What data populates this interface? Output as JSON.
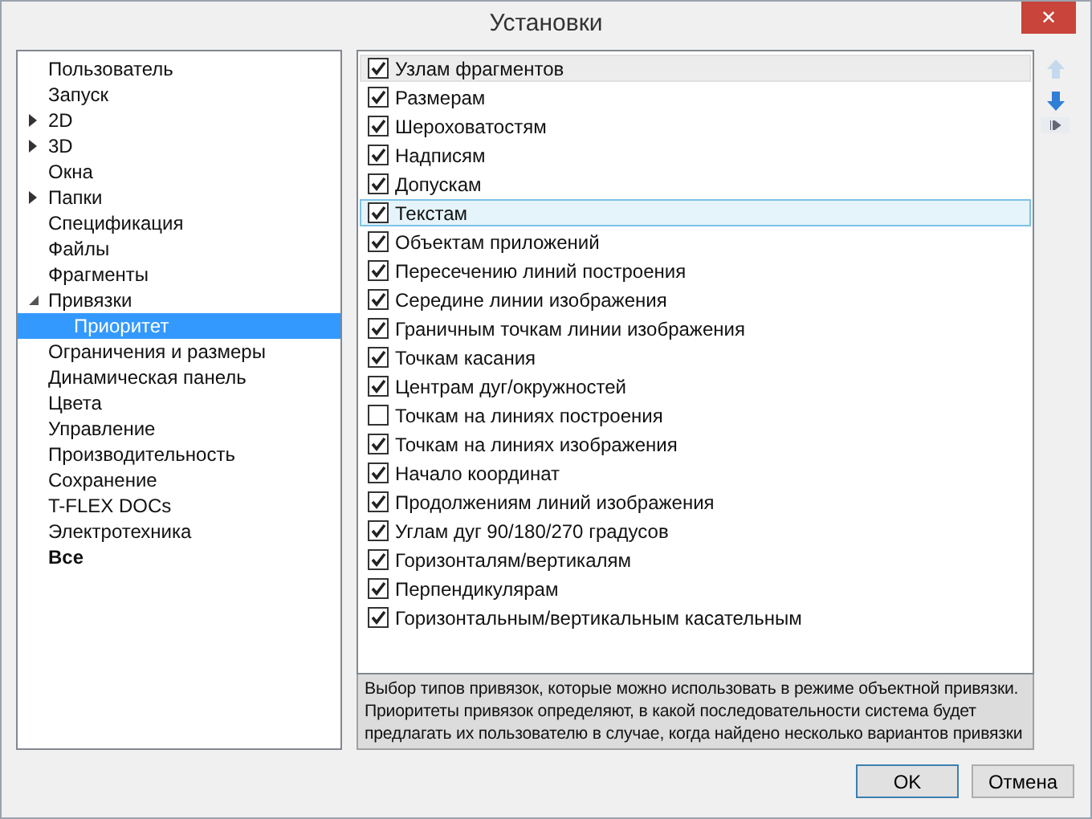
{
  "window": {
    "title": "Установки",
    "close": "✕"
  },
  "tree": [
    {
      "label": "Пользователь",
      "selected": false,
      "bold": false
    },
    {
      "label": "Запуск",
      "selected": false,
      "bold": false
    },
    {
      "label": "2D",
      "selected": false,
      "bold": false,
      "expanded": false
    },
    {
      "label": "3D",
      "selected": false,
      "bold": false,
      "expanded": false
    },
    {
      "label": "Окна",
      "selected": false,
      "bold": false
    },
    {
      "label": "Папки",
      "selected": false,
      "bold": false,
      "expanded": false
    },
    {
      "label": "Спецификация",
      "selected": false,
      "bold": false
    },
    {
      "label": "Файлы",
      "selected": false,
      "bold": false
    },
    {
      "label": "Фрагменты",
      "selected": false,
      "bold": false
    },
    {
      "label": "Привязки",
      "selected": false,
      "bold": false,
      "expanded": true,
      "children": [
        {
          "label": "Приоритет",
          "selected": true,
          "bold": false
        }
      ]
    },
    {
      "label": "Ограничения и размеры",
      "selected": false,
      "bold": false
    },
    {
      "label": "Динамическая панель",
      "selected": false,
      "bold": false
    },
    {
      "label": "Цвета",
      "selected": false,
      "bold": false
    },
    {
      "label": "Управление",
      "selected": false,
      "bold": false
    },
    {
      "label": "Производительность",
      "selected": false,
      "bold": false
    },
    {
      "label": "Сохранение",
      "selected": false,
      "bold": false
    },
    {
      "label": "T-FLEX DOCs",
      "selected": false,
      "bold": false
    },
    {
      "label": "Электротехника",
      "selected": false,
      "bold": false
    },
    {
      "label": "Все",
      "selected": false,
      "bold": true
    }
  ],
  "snaps": [
    {
      "label": "Узлам фрагментов",
      "checked": true,
      "selected": false,
      "hovered": true
    },
    {
      "label": "Размерам",
      "checked": true,
      "selected": false,
      "hovered": false
    },
    {
      "label": "Шероховатостям",
      "checked": true,
      "selected": false,
      "hovered": false
    },
    {
      "label": "Надписям",
      "checked": true,
      "selected": false,
      "hovered": false
    },
    {
      "label": "Допускам",
      "checked": true,
      "selected": false,
      "hovered": false
    },
    {
      "label": "Текстам",
      "checked": true,
      "selected": true,
      "hovered": false
    },
    {
      "label": "Объектам приложений",
      "checked": true,
      "selected": false,
      "hovered": false
    },
    {
      "label": "Пересечению линий построения",
      "checked": true,
      "selected": false,
      "hovered": false
    },
    {
      "label": "Середине линии изображения",
      "checked": true,
      "selected": false,
      "hovered": false
    },
    {
      "label": "Граничным точкам линии изображения",
      "checked": true,
      "selected": false,
      "hovered": false
    },
    {
      "label": "Точкам касания",
      "checked": true,
      "selected": false,
      "hovered": false
    },
    {
      "label": "Центрам дуг/окружностей",
      "checked": true,
      "selected": false,
      "hovered": false
    },
    {
      "label": "Точкам на линиях построения",
      "checked": false,
      "selected": false,
      "hovered": false
    },
    {
      "label": "Точкам на линиях изображения",
      "checked": true,
      "selected": false,
      "hovered": false
    },
    {
      "label": "Начало координат",
      "checked": true,
      "selected": false,
      "hovered": false
    },
    {
      "label": "Продолжениям линий изображения",
      "checked": true,
      "selected": false,
      "hovered": false
    },
    {
      "label": "Углам дуг 90/180/270 градусов",
      "checked": true,
      "selected": false,
      "hovered": false
    },
    {
      "label": "Горизонталям/вертикалям",
      "checked": true,
      "selected": false,
      "hovered": false
    },
    {
      "label": "Перпендикулярам",
      "checked": true,
      "selected": false,
      "hovered": false
    },
    {
      "label": "Горизонтальным/вертикальным касательным",
      "checked": true,
      "selected": false,
      "hovered": false
    }
  ],
  "side_buttons": [
    {
      "kind": "up",
      "disabled": true
    },
    {
      "kind": "down",
      "disabled": false
    },
    {
      "kind": "more",
      "disabled": false
    }
  ],
  "description": "Выбор типов привязок, которые можно использовать в режиме объектной привязки. Приоритеты привязок определяют, в какой последовательности система будет предлагать их пользователю в случае, когда найдено несколько вариантов привязки",
  "buttons": [
    {
      "label": "OK",
      "default": true
    },
    {
      "label": "Отмена",
      "default": false
    }
  ]
}
